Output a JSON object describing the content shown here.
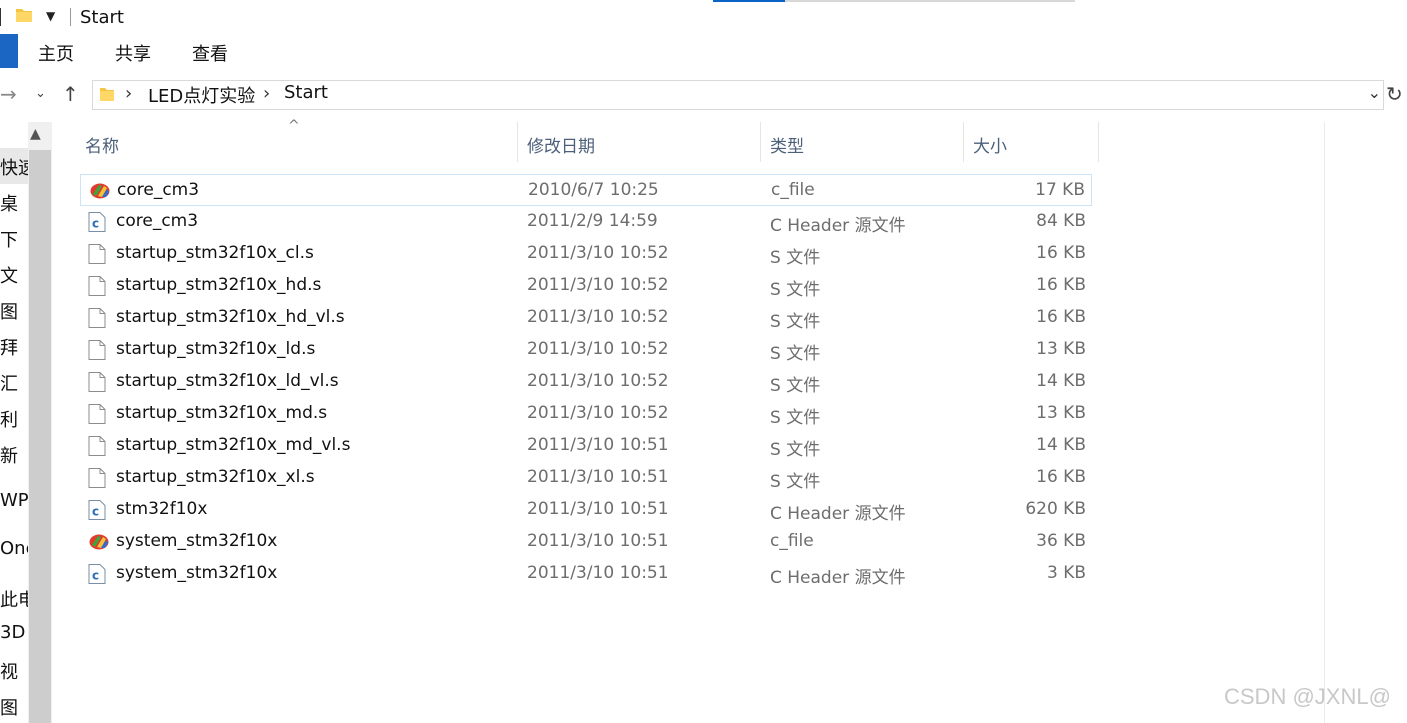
{
  "window": {
    "title": "Start"
  },
  "ribbon": {
    "tabs": [
      "主页",
      "共享",
      "查看"
    ]
  },
  "address": {
    "crumbs": [
      "LED点灯实验",
      "Start"
    ]
  },
  "nav_pane": {
    "items": [
      "快速",
      "桌",
      "下",
      "文",
      "图",
      "拜",
      "汇",
      "利",
      "新",
      "WP",
      "One",
      "此电",
      "3D",
      "视",
      "图"
    ]
  },
  "columns": {
    "name": "名称",
    "date": "修改日期",
    "type": "类型",
    "size": "大小"
  },
  "files": [
    {
      "name": "core_cm3",
      "date": "2010/6/7 10:25",
      "type": "c_file",
      "size": "17 KB",
      "icon": "c-file-colorful-icon"
    },
    {
      "name": "core_cm3",
      "date": "2011/2/9 14:59",
      "type": "C Header 源文件",
      "size": "84 KB",
      "icon": "c-header-icon"
    },
    {
      "name": "startup_stm32f10x_cl.s",
      "date": "2011/3/10 10:52",
      "type": "S 文件",
      "size": "16 KB",
      "icon": "blank-file-icon"
    },
    {
      "name": "startup_stm32f10x_hd.s",
      "date": "2011/3/10 10:52",
      "type": "S 文件",
      "size": "16 KB",
      "icon": "blank-file-icon"
    },
    {
      "name": "startup_stm32f10x_hd_vl.s",
      "date": "2011/3/10 10:52",
      "type": "S 文件",
      "size": "16 KB",
      "icon": "blank-file-icon"
    },
    {
      "name": "startup_stm32f10x_ld.s",
      "date": "2011/3/10 10:52",
      "type": "S 文件",
      "size": "13 KB",
      "icon": "blank-file-icon"
    },
    {
      "name": "startup_stm32f10x_ld_vl.s",
      "date": "2011/3/10 10:52",
      "type": "S 文件",
      "size": "14 KB",
      "icon": "blank-file-icon"
    },
    {
      "name": "startup_stm32f10x_md.s",
      "date": "2011/3/10 10:52",
      "type": "S 文件",
      "size": "13 KB",
      "icon": "blank-file-icon"
    },
    {
      "name": "startup_stm32f10x_md_vl.s",
      "date": "2011/3/10 10:51",
      "type": "S 文件",
      "size": "14 KB",
      "icon": "blank-file-icon"
    },
    {
      "name": "startup_stm32f10x_xl.s",
      "date": "2011/3/10 10:51",
      "type": "S 文件",
      "size": "16 KB",
      "icon": "blank-file-icon"
    },
    {
      "name": "stm32f10x",
      "date": "2011/3/10 10:51",
      "type": "C Header 源文件",
      "size": "620 KB",
      "icon": "c-header-icon"
    },
    {
      "name": "system_stm32f10x",
      "date": "2011/3/10 10:51",
      "type": "c_file",
      "size": "36 KB",
      "icon": "c-file-colorful-icon"
    },
    {
      "name": "system_stm32f10x",
      "date": "2011/3/10 10:51",
      "type": "C Header 源文件",
      "size": "3 KB",
      "icon": "c-header-icon"
    }
  ],
  "watermark": "CSDN @JXNL@",
  "colors": {
    "accent": "#1a66c2",
    "header_text": "#4c607a",
    "selection_border": "#cce4f7"
  }
}
